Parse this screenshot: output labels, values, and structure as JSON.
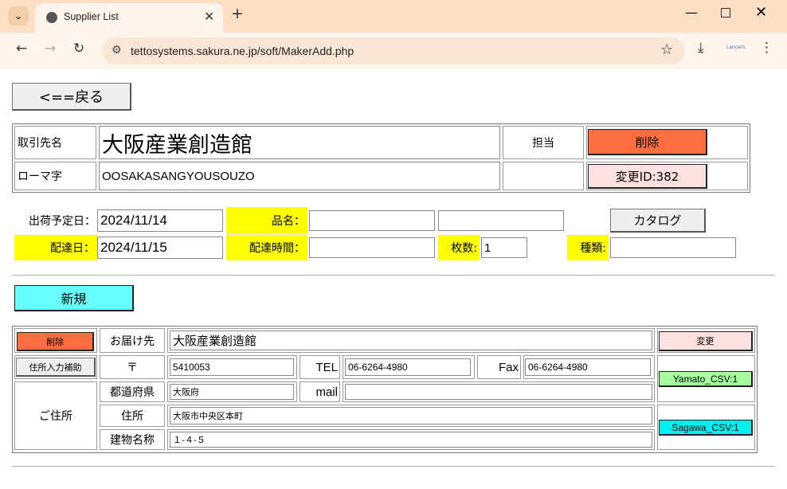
{
  "browser": {
    "tab_title": "Supplier List",
    "url": "tettosystems.sakura.ne.jp/soft/MakerAdd.php",
    "extension_label": "Lancers"
  },
  "back_button": "<==戻る",
  "supplier": {
    "name_label": "取引先名",
    "name_value": "大阪産業創造館",
    "romaji_label": "ローマ字",
    "romaji_value": "OOSAKASANGYOUSOUZO",
    "staff_label": "担当",
    "staff_value": "",
    "delete_label": "削除",
    "change_id_label": "変更ID:382"
  },
  "order": {
    "ship_date_label": "出荷予定日：",
    "ship_date_value": "2024/11/14",
    "product_label": "品名：",
    "product_value_1": "",
    "product_value_2": "",
    "catalog_label": "カタログ",
    "delivery_date_label": "配達日：",
    "delivery_date_value": "2024/11/15",
    "delivery_time_label": "配達時間：",
    "delivery_time_value": "",
    "count_label": "枚数:",
    "count_value": "1",
    "kind_label": "種類:",
    "kind_value": ""
  },
  "new_button": "新規",
  "address": {
    "delete_label": "削除",
    "recipient_label": "お届け先",
    "recipient_value": "大阪産業創造館",
    "change_label": "変更",
    "assist_label": "住所入力補助",
    "postal_mark": "〒",
    "postal_value": "5410053",
    "tel_label": "TEL",
    "tel_value": "06-6264-4980",
    "fax_label": "Fax",
    "fax_value": "06-6264-4980",
    "yamato_label": "Yamato_CSV:1",
    "address_label": "ご住所",
    "prefecture_label": "都道府県",
    "prefecture_value": "大阪府",
    "mail_label": "mail",
    "mail_value": "",
    "street_label": "住所",
    "street_value": "大阪市中央区本町",
    "building_label": "建物名称",
    "building_value": "１-４-５",
    "sagawa_label": "Sagawa_CSV:1"
  },
  "colors": {
    "delete_red": "#ff6e40",
    "change_pink": "#fde0e0",
    "new_cyan": "#66ffff",
    "yamato_green": "#a6ff9c",
    "sagawa_cyan": "#00f0f0",
    "label_yellow": "#ffff00"
  }
}
